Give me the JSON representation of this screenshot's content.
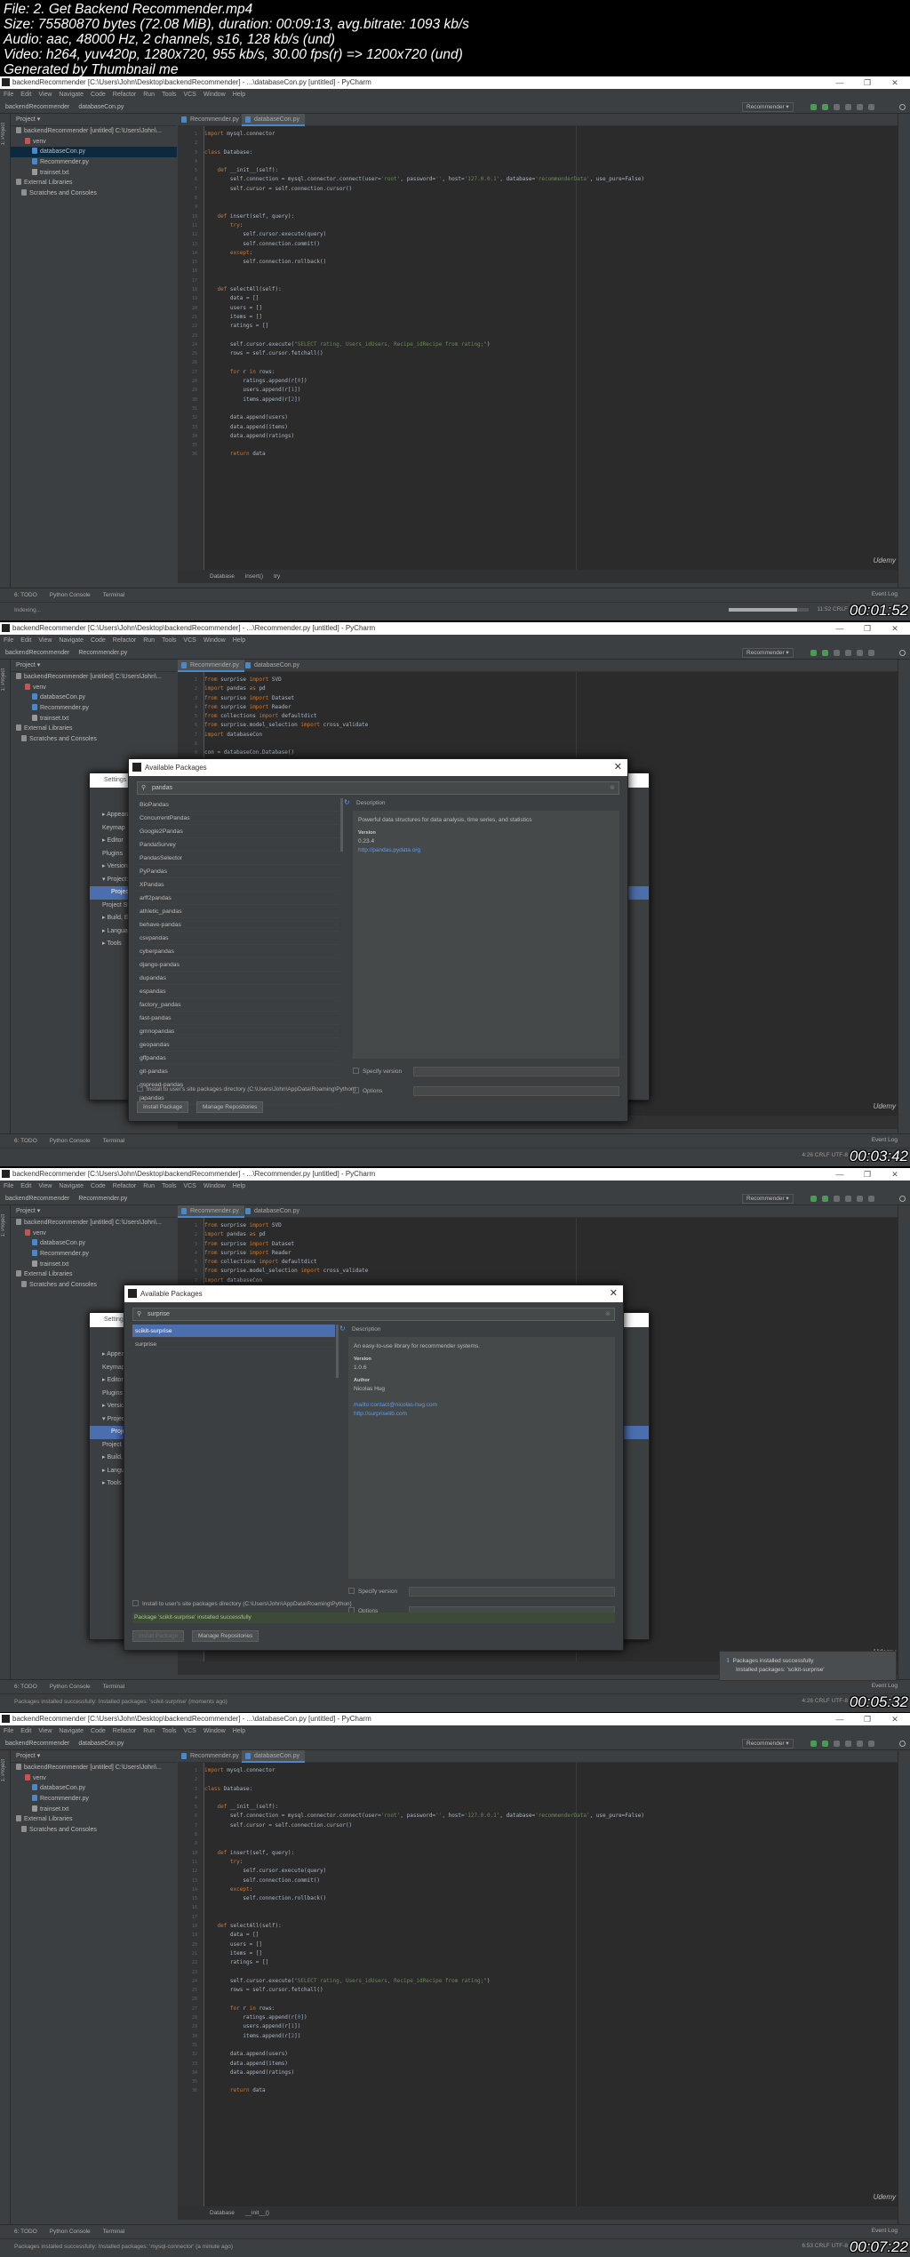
{
  "header": {
    "lines": [
      "File: 2. Get Backend Recommender.mp4",
      "Size: 75580870 bytes (72.08 MiB), duration: 00:09:13, avg.bitrate: 1093 kb/s",
      "Audio: aac, 48000 Hz, 2 channels, s16, 128 kb/s (und)",
      "Video: h264, yuv420p, 1280x720, 955 kb/s, 30.00 fps(r) => 1200x720 (und)",
      "Generated by Thumbnail me"
    ]
  },
  "common": {
    "menu": [
      "File",
      "Edit",
      "View",
      "Navigate",
      "Code",
      "Refactor",
      "Run",
      "Tools",
      "VCS",
      "Window",
      "Help"
    ],
    "project_label": "Project ▾",
    "project_strip": "1: Project",
    "run_config": "Recommender ▾",
    "tool_tabs": [
      "6: TODO",
      "Python Console",
      "Terminal"
    ],
    "event_log": "Event Log",
    "watermark": "Udemy",
    "window_controls": [
      "—",
      "❐",
      "✕"
    ],
    "tabs": [
      "Recommender.py",
      "databaseCon.py"
    ],
    "colors": {
      "accent": "#4b6eaf",
      "editor_bg": "#2b2b2b",
      "panel_bg": "#3c3f41",
      "keyword": "#cc7832",
      "string": "#6a8759"
    }
  },
  "code": {
    "databaseCon": [
      "import mysql.connector",
      "",
      "class Database:",
      "",
      "    def __init__(self):",
      "        self.connection = mysql.connector.connect(user='root', password='', host='127.0.0.1', database='recommenderData', use_pure=False)",
      "        self.cursor = self.connection.cursor()",
      "",
      "",
      "    def insert(self, query):",
      "        try:",
      "            self.cursor.execute(query)",
      "            self.connection.commit()",
      "        except:",
      "            self.connection.rollback()",
      "",
      "",
      "    def selectAll(self):",
      "        data = []",
      "        users = []",
      "        items = []",
      "        ratings = []",
      "",
      "        self.cursor.execute(\"SELECT rating, Users_idUsers, Recipe_idRecipe from rating;\")",
      "        rows = self.cursor.fetchall()",
      "",
      "        for r in rows:",
      "            ratings.append(r[0])",
      "            users.append(r[1])",
      "            items.append(r[2])",
      "",
      "        data.append(users)",
      "        data.append(items)",
      "        data.append(ratings)",
      "",
      "        return data"
    ],
    "recommender": [
      "from surprise import SVD",
      "import pandas as pd",
      "from surprise import Dataset",
      "from surprise import Reader",
      "from collections import defaultdict",
      "from surprise.model_selection import cross_validate",
      "import databaseCon",
      "",
      "con = databaseCon.Database()"
    ]
  },
  "frames": [
    {
      "title": "backendRecommender [C:\\Users\\John\\Desktop\\backendRecommender] - ...\\databaseCon.py [untitled] - PyCharm",
      "nav": [
        "backendRecommender",
        "databaseCon.py"
      ],
      "tree": [
        "backendRecommender [untitled]  C:\\Users\\John\\...",
        "venv",
        "databaseCon.py",
        "Recommender.py",
        "trainset.txt",
        "External Libraries",
        "Scratches and Consoles"
      ],
      "selected_tree": 2,
      "active_tab": 1,
      "code_key": "databaseCon",
      "breadcrumb": [
        "Database",
        "insert()",
        "try"
      ],
      "status_left": "Indexing...",
      "status_right": "11:52  CRLF",
      "indexing_progress": 0.85,
      "timestamp": "00:01:52"
    },
    {
      "title": "backendRecommender [C:\\Users\\John\\Desktop\\backendRecommender] - ...\\Recommender.py [untitled] - PyCharm",
      "nav": [
        "backendRecommender",
        "Recommender.py"
      ],
      "tree": [
        "backendRecommender [untitled]  C:\\Users\\John\\...",
        "venv",
        "databaseCon.py",
        "Recommender.py",
        "trainset.txt",
        "External Libraries",
        "Scratches and Consoles"
      ],
      "selected_tree": -1,
      "active_tab": 0,
      "code_key": "recommender",
      "breadcrumb": [],
      "status_left": "",
      "status_right": "4:26  CRLF  UTF-8",
      "timestamp": "00:03:42",
      "settings": {
        "title": "Settings",
        "items": [
          "▸ Appearance & Behavior",
          "Keymap",
          "▸ Editor",
          "Plugins",
          "▸ Version Control",
          "▾ Project: backendRecommender",
          "Project Interpreter",
          "Project Structure",
          "▸ Build, Execution, Deployment",
          "▸ Languages & Frameworks",
          "▸ Tools"
        ],
        "selected": 6
      },
      "dialog": {
        "title": "Available Packages",
        "search": "pandas",
        "packages": [
          "BioPandas",
          "ConcurrentPandas",
          "Google2Pandas",
          "PandaSurvey",
          "PandasSelector",
          "PyPandas",
          "XPandas",
          "arff2pandas",
          "athletic_pandas",
          "behave-pandas",
          "csvpandas",
          "cyberpandas",
          "django-pandas",
          "dupandas",
          "espandas",
          "factory_pandas",
          "fast-pandas",
          "gmnopandas",
          "geopandas",
          "gffpandas",
          "git-pandas",
          "gspread-pandas",
          "japandas"
        ],
        "selected": -1,
        "description_label": "Description",
        "description": "Powerful data structures for data analysis, time series, and statistics",
        "version_label": "Version",
        "version": "0.23.4",
        "author_label": "",
        "author": "",
        "links": [
          "http://pandas.pydata.org"
        ],
        "specify_version": "Specify version",
        "options": "Options",
        "user_site": "Install to user's site packages directory (C:\\Users\\John\\AppData\\Roaming\\Python)",
        "message": "",
        "install": "Install Package",
        "manage": "Manage Repositories"
      }
    },
    {
      "title": "backendRecommender [C:\\Users\\John\\Desktop\\backendRecommender] - ...\\Recommender.py [untitled] - PyCharm",
      "nav": [
        "backendRecommender",
        "Recommender.py"
      ],
      "tree": [
        "backendRecommender [untitled]  C:\\Users\\John\\...",
        "venv",
        "databaseCon.py",
        "Recommender.py",
        "trainset.txt",
        "External Libraries",
        "Scratches and Consoles"
      ],
      "selected_tree": -1,
      "active_tab": 0,
      "code_key": "recommender",
      "breadcrumb": [],
      "status_left": "Packages installed successfully: Installed packages: 'scikit-surprise' (moments ago)",
      "status_right": "4:26  CRLF  UTF-8",
      "timestamp": "00:05:32",
      "settings": {
        "title": "Settings",
        "items": [
          "▸ Appearance & Behavior",
          "Keymap",
          "▸ Editor",
          "Plugins",
          "▸ Version Control",
          "▾ Project: backendRecommender",
          "Project Interpreter",
          "Project Structure",
          "▸ Build, Execution, Deployment",
          "▸ Languages & Frameworks",
          "▸ Tools"
        ],
        "selected": 6
      },
      "dialog": {
        "title": "Available Packages",
        "search": "surprise",
        "packages": [
          "scikit-surprise",
          "surprise"
        ],
        "selected": 0,
        "description_label": "Description",
        "description": "An easy-to-use library for recommender systems.",
        "version_label": "Version",
        "version": "1.0.6",
        "author_label": "Author",
        "author": "Nicolas Hug",
        "links": [
          "mailto:contact@nicolas-hug.com",
          "http://surpriselib.com"
        ],
        "specify_version": "Specify version",
        "options": "Options",
        "user_site": "Install to user's site packages directory (C:\\Users\\John\\AppData\\Roaming\\Python)",
        "message": "Package 'scikit-surprise' installed successfully",
        "install": "Install Package",
        "manage": "Manage Repositories"
      },
      "notification": {
        "title": "Packages installed successfully",
        "body": "Installed packages: 'scikit-surprise'"
      }
    },
    {
      "title": "backendRecommender [C:\\Users\\John\\Desktop\\backendRecommender] - ...\\databaseCon.py [untitled] - PyCharm",
      "nav": [
        "backendRecommender",
        "databaseCon.py"
      ],
      "tree": [
        "backendRecommender [untitled]  C:\\Users\\John\\...",
        "venv",
        "databaseCon.py",
        "Recommender.py",
        "trainset.txt",
        "External Libraries",
        "Scratches and Consoles"
      ],
      "selected_tree": -1,
      "active_tab": 1,
      "code_key": "databaseCon",
      "breadcrumb": [
        "Database",
        "__init__()"
      ],
      "status_left": "Packages installed successfully: Installed packages: 'mysql-connector' (a minute ago)",
      "status_right": "6:53  CRLF  UTF-8",
      "timestamp": "00:07:22"
    }
  ]
}
